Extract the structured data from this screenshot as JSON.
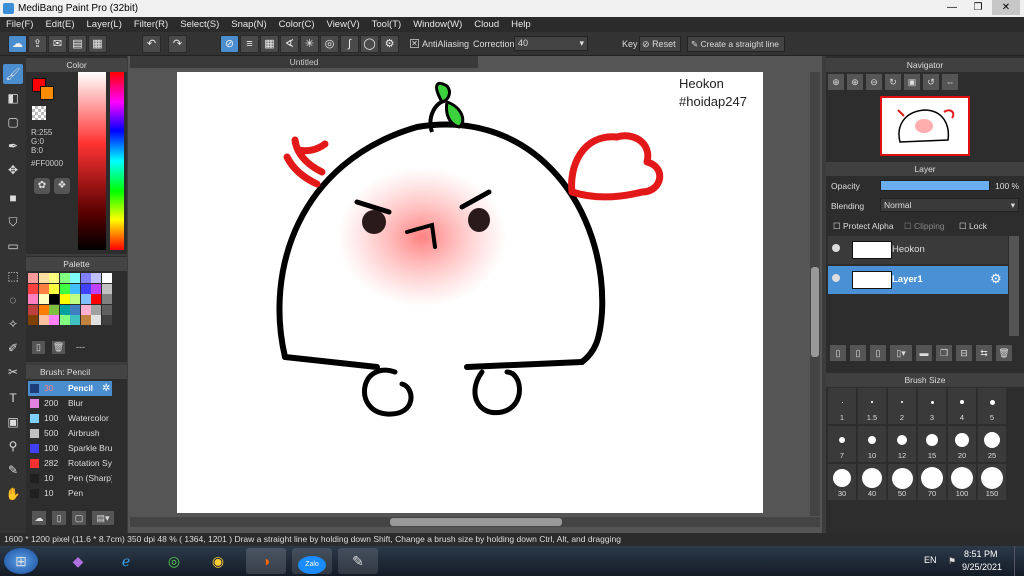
{
  "window": {
    "title": "MediBang Paint Pro (32bit)"
  },
  "menu": [
    "File(F)",
    "Edit(E)",
    "Layer(L)",
    "Filter(R)",
    "Select(S)",
    "Snap(N)",
    "Color(C)",
    "View(V)",
    "Tool(T)",
    "Window(W)",
    "Cloud",
    "Help"
  ],
  "toolbar": {
    "antialias": "AntiAliasing",
    "correction_label": "Correction",
    "correction_value": "40",
    "key_label": "Key",
    "reset": "Reset",
    "straight": "Create a straight line"
  },
  "doc_tab": "Untitled",
  "color_panel": {
    "title": "Color",
    "readout": [
      "R:255",
      "G:0",
      "B:0"
    ],
    "hex": "#FF0000",
    "primary": "#ff0000",
    "secondary": "#ff8c00"
  },
  "palette": {
    "title": "Palette",
    "colors": [
      "#ff9a9a",
      "#ffe0a0",
      "#ffff80",
      "#80ff80",
      "#80ffff",
      "#8080ff",
      "#c0c0ff",
      "#ffffff",
      "#ff4040",
      "#ff8040",
      "#ffff40",
      "#40ff40",
      "#40c0ff",
      "#4040ff",
      "#c040ff",
      "#c0c0c0",
      "#ff80c0",
      "#ffffc0",
      "#000000",
      "#ffff00",
      "#c0ff80",
      "#80c0ff",
      "#ff0000",
      "#808080",
      "#c04040",
      "#ff8000",
      "#80c040",
      "#00a0a0",
      "#4080c0",
      "#ffb0d0",
      "#a0a0a0",
      "#606060",
      "#804000",
      "#ffc0a0",
      "#ff80ff",
      "#80ff80",
      "#40c0c0",
      "#c08040",
      "#e0e0e0",
      "#404040"
    ],
    "extra": "---"
  },
  "brush": {
    "title": "Brush: Pencil",
    "items": [
      {
        "size": "30",
        "name": "Pencil",
        "color": "#1e3c78",
        "sel": true
      },
      {
        "size": "200",
        "name": "Blur",
        "color": "#e080e0"
      },
      {
        "size": "100",
        "name": "Watercolor",
        "color": "#80d0ff"
      },
      {
        "size": "500",
        "name": "Airbrush",
        "color": "#c0c0c0"
      },
      {
        "size": "100",
        "name": "Sparkle Brush",
        "color": "#4040ff"
      },
      {
        "size": "282",
        "name": "Rotation Sym",
        "color": "#ff3030"
      },
      {
        "size": "10",
        "name": "Pen (Sharp)",
        "color": "#202020"
      },
      {
        "size": "10",
        "name": "Pen",
        "color": "#202020"
      }
    ]
  },
  "artwork": {
    "text1": "Heokon",
    "text2": "#hoidap247"
  },
  "navigator": {
    "title": "Navigator"
  },
  "layer": {
    "title": "Layer",
    "opacity_label": "Opacity",
    "opacity_value": "100 %",
    "blending_label": "Blending",
    "blending_value": "Normal",
    "protect_alpha": "Protect Alpha",
    "clipping": "Clipping",
    "lock": "Lock",
    "layers": [
      {
        "name": "Heokon",
        "sel": false
      },
      {
        "name": "Layer1",
        "sel": true
      }
    ]
  },
  "brush_size": {
    "title": "Brush Size",
    "sizes": [
      "1",
      "1.5",
      "2",
      "3",
      "4",
      "5",
      "7",
      "10",
      "12",
      "15",
      "20",
      "25",
      "30",
      "40",
      "50",
      "70",
      "100",
      "150"
    ]
  },
  "status": "1600 * 1200 pixel   (11.6 * 8.7cm)   350 dpi   48 %   ( 1364, 1201 )   Draw a straight line by holding down Shift, Change a brush size by holding down Ctrl, Alt, and dragging",
  "taskbar": {
    "lang": "EN",
    "time": "8:51 PM",
    "date": "9/25/2021",
    "zalo": "Zalo"
  }
}
